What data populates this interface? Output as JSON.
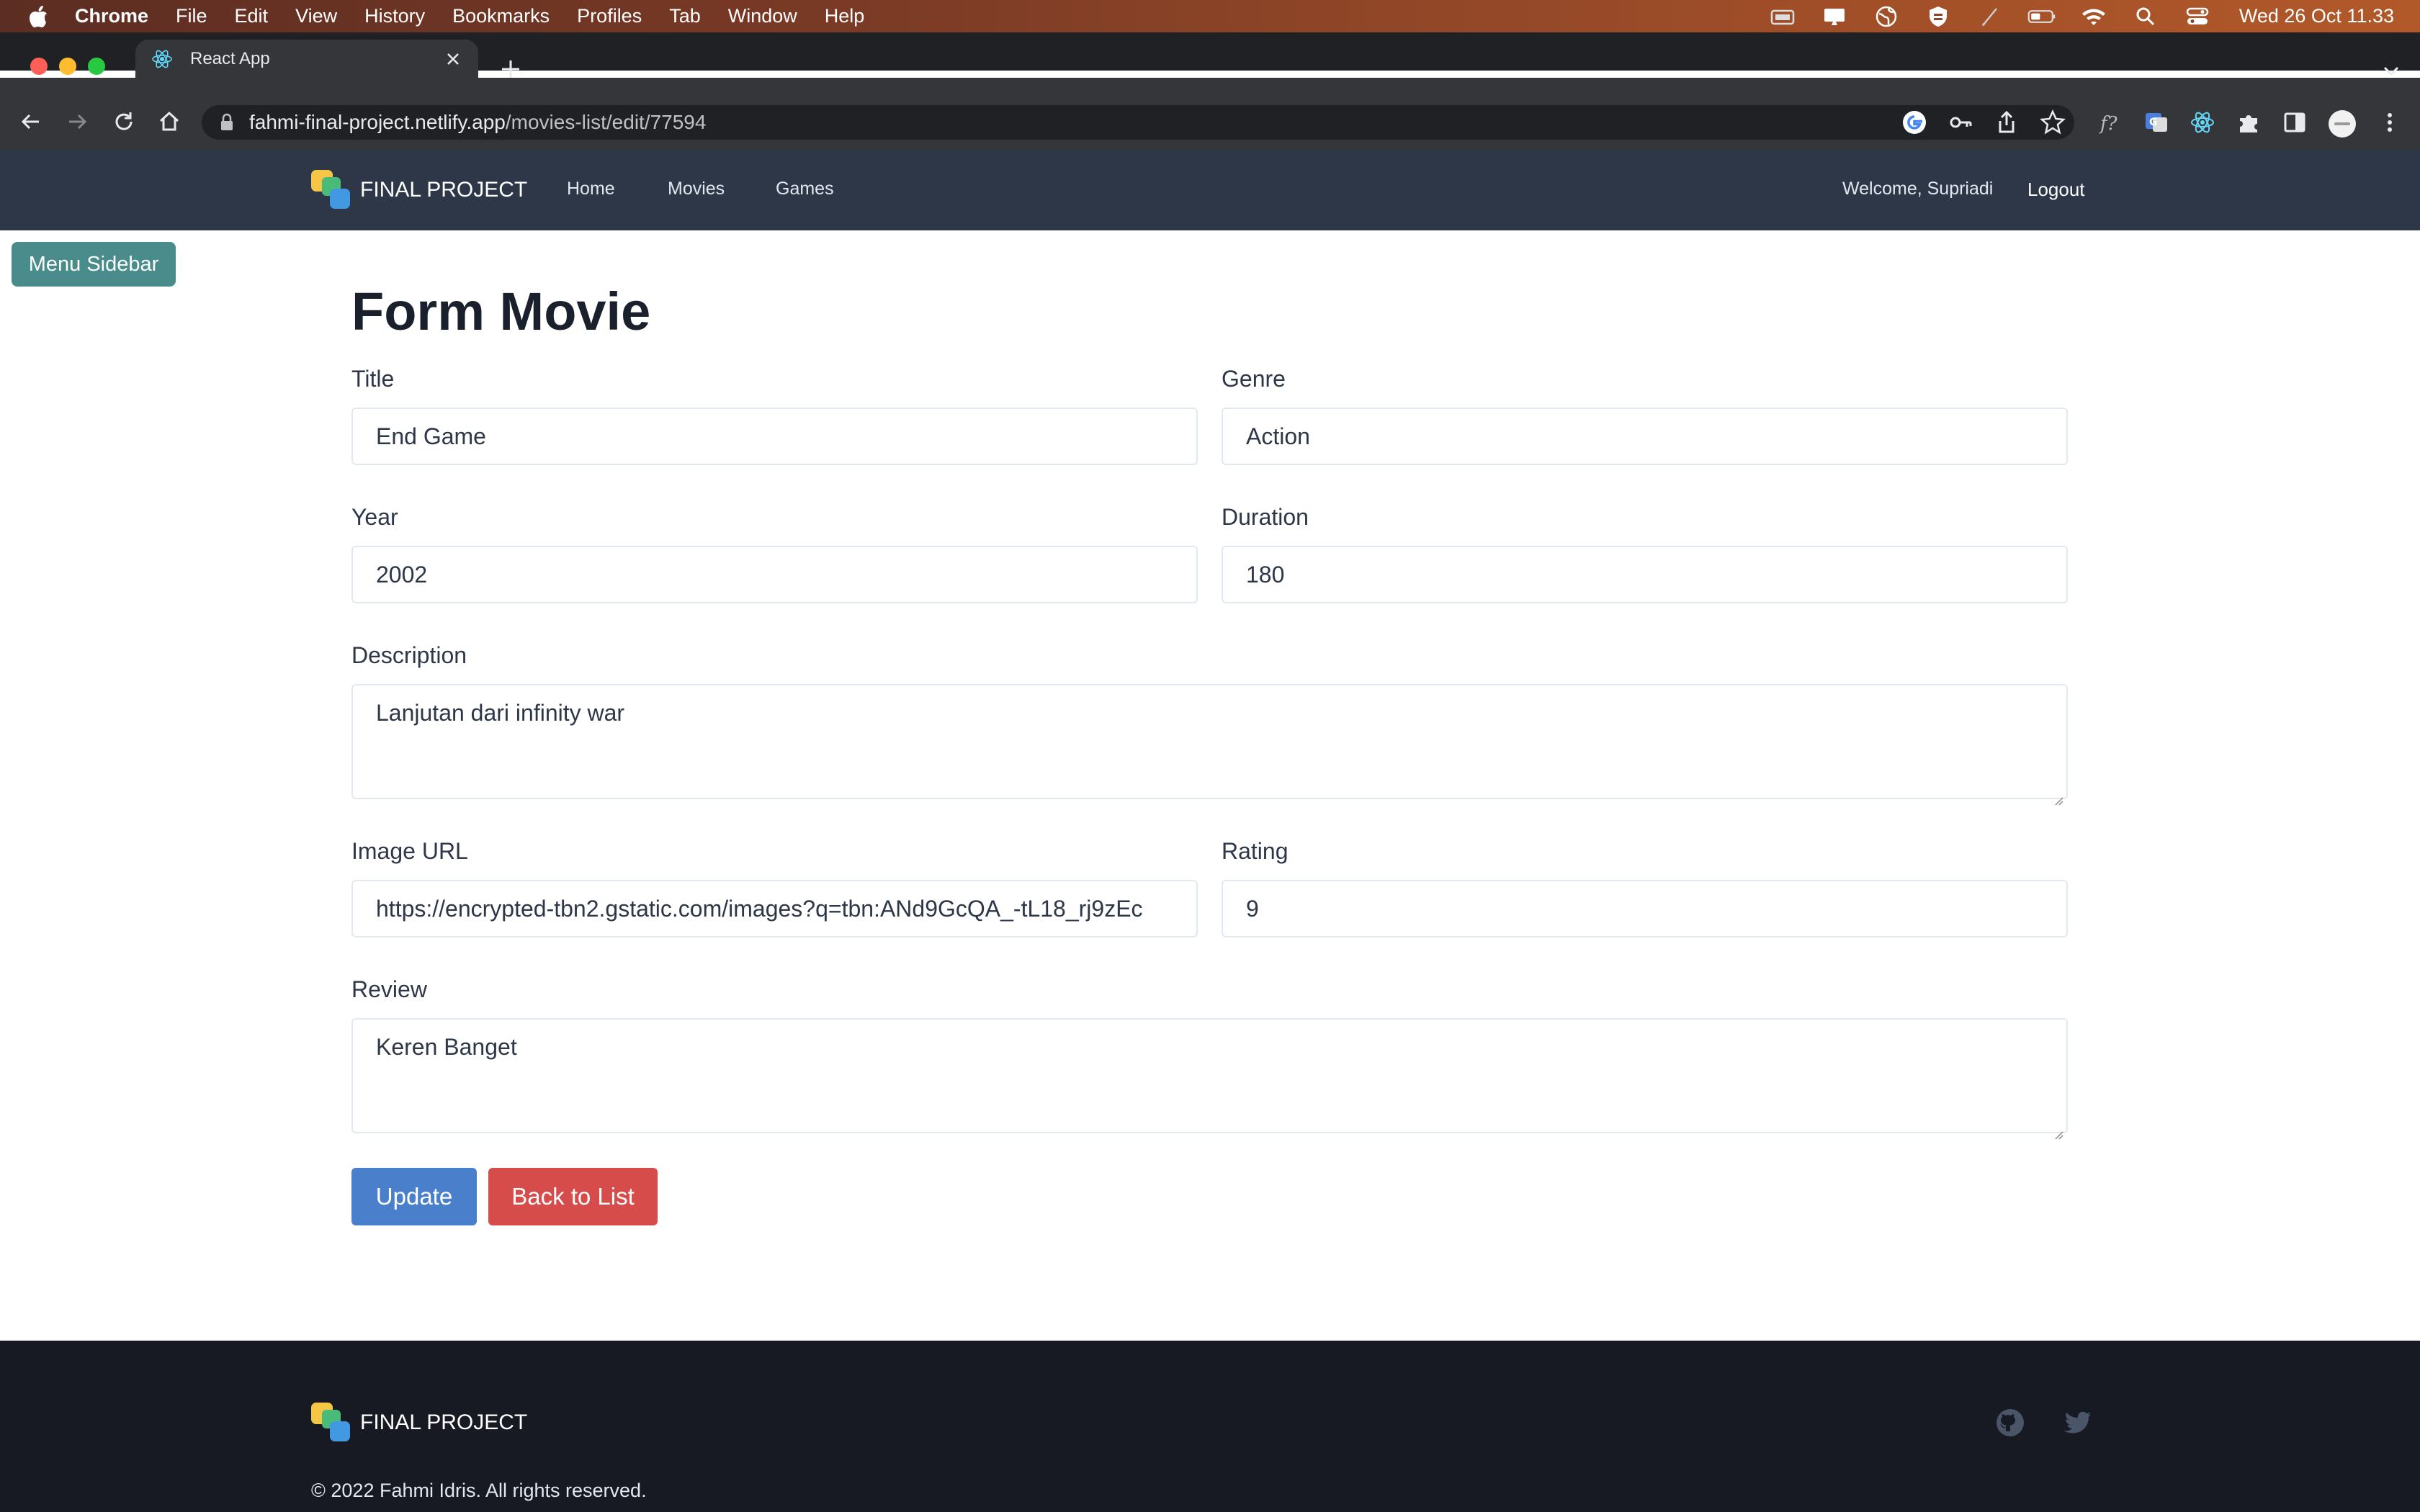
{
  "menubar": {
    "app": "Chrome",
    "items": [
      "File",
      "Edit",
      "View",
      "History",
      "Bookmarks",
      "Profiles",
      "Tab",
      "Window",
      "Help"
    ],
    "clock": "Wed 26 Oct  11.33"
  },
  "browser": {
    "tab_title": "React App",
    "url_host": "fahmi-final-project.netlify.app",
    "url_path": "/movies-list/edit/77594"
  },
  "navbar": {
    "brand": "FINAL PROJECT",
    "links": [
      "Home",
      "Movies",
      "Games"
    ],
    "welcome": "Welcome, Supriadi",
    "logout": "Logout"
  },
  "sidebar_button": "Menu Sidebar",
  "form": {
    "heading": "Form Movie",
    "title_label": "Title",
    "title_value": "End Game",
    "genre_label": "Genre",
    "genre_value": "Action",
    "year_label": "Year",
    "year_value": "2002",
    "duration_label": "Duration",
    "duration_value": "180",
    "description_label": "Description",
    "description_value": "Lanjutan dari infinity war",
    "image_url_label": "Image URL",
    "image_url_value": "https://encrypted-tbn2.gstatic.com/images?q=tbn:ANd9GcQA_-tL18_rj9zEc",
    "rating_label": "Rating",
    "rating_value": "9",
    "review_label": "Review",
    "review_value": "Keren Banget",
    "update_button": "Update",
    "back_button": "Back to List"
  },
  "colors": {
    "navbar_bg": "#2d3748",
    "footer_bg": "#171923",
    "update_button": "#4a7fcb",
    "back_button": "#d64c4a",
    "sidebar_button": "#4a8b8b"
  },
  "footer": {
    "brand": "FINAL PROJECT",
    "copyright": "© 2022 Fahmi Idris. All rights reserved.",
    "icons": [
      "github-icon",
      "twitter-icon"
    ]
  }
}
